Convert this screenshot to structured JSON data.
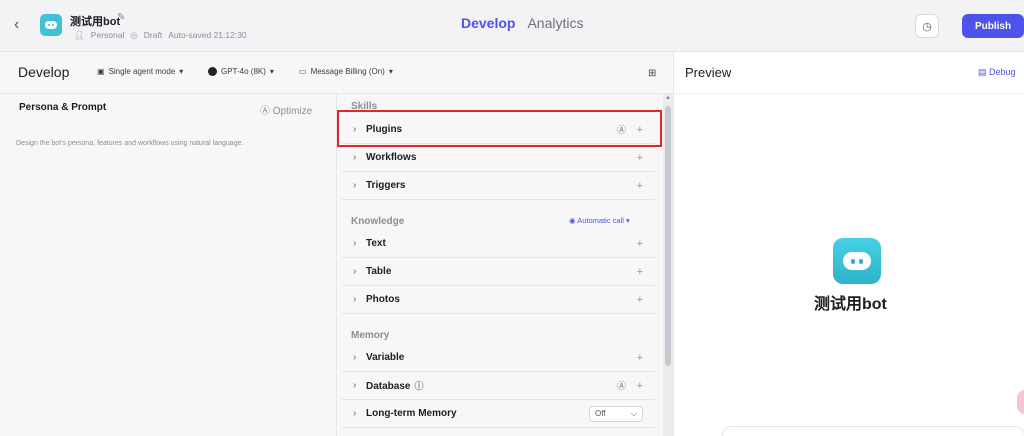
{
  "topbar": {
    "back_icon": "chevron-left-icon",
    "bot_name": "测试用bot",
    "meta": {
      "owner": "Personal",
      "status": "Draft",
      "autosave": "Auto-saved 21:12:30"
    },
    "tabs": [
      {
        "label": "Develop",
        "active": true
      },
      {
        "label": "Analytics",
        "active": false
      }
    ],
    "publish_label": "Publish",
    "accent_color": "#4d53e8"
  },
  "develop": {
    "title": "Develop",
    "mode": "Single agent mode",
    "model": "GPT-4o (8K)",
    "billing": "Message Billing (On)"
  },
  "persona": {
    "title": "Persona & Prompt",
    "optimize_label": "Optimize",
    "placeholder": "Design the bot's persona, features and workflows using natural language."
  },
  "skills": {
    "section_label": "Skills",
    "items": [
      {
        "label": "Plugins"
      },
      {
        "label": "Workflows"
      },
      {
        "label": "Triggers"
      }
    ]
  },
  "knowledge": {
    "section_label": "Knowledge",
    "auto_call_label": "Automatic call",
    "items": [
      {
        "label": "Text"
      },
      {
        "label": "Table"
      },
      {
        "label": "Photos"
      }
    ]
  },
  "memory": {
    "section_label": "Memory",
    "items": [
      {
        "label": "Variable"
      },
      {
        "label": "Database"
      },
      {
        "label": "Long-term Memory",
        "value": "Off"
      }
    ]
  },
  "preview": {
    "title": "Preview",
    "debug_label": "Debug",
    "bot_name": "测试用bot"
  }
}
